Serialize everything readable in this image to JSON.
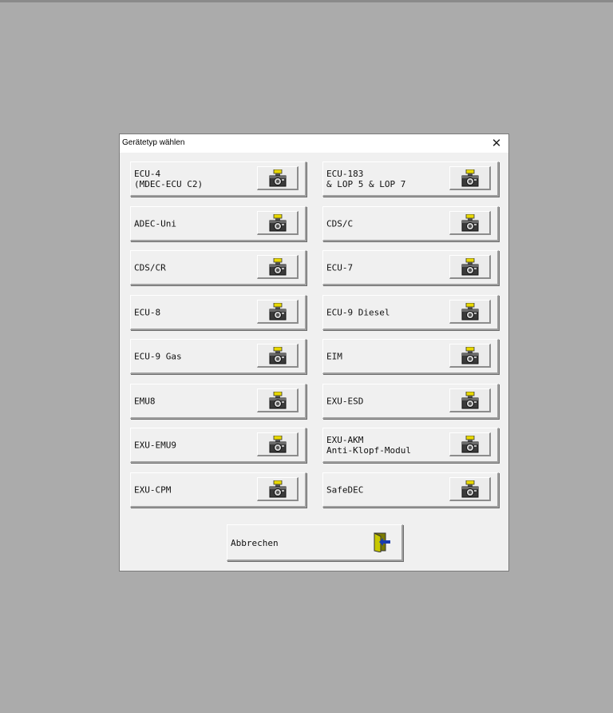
{
  "dialog": {
    "title": "Gerätetyp wählen",
    "close_symbol": "✕"
  },
  "devices": [
    {
      "line1": "ECU-4",
      "line2": "(MDEC-ECU C2)",
      "icon": "camera-icon"
    },
    {
      "line1": "ECU-183",
      "line2": "& LOP 5 & LOP 7",
      "icon": "camera-icon"
    },
    {
      "line1": "ADEC-Uni",
      "line2": "",
      "icon": "camera-icon"
    },
    {
      "line1": "CDS/C",
      "line2": "",
      "icon": "camera-icon"
    },
    {
      "line1": "CDS/CR",
      "line2": "",
      "icon": "camera-icon"
    },
    {
      "line1": "ECU-7",
      "line2": "",
      "icon": "camera-icon"
    },
    {
      "line1": "ECU-8",
      "line2": "",
      "icon": "camera-icon"
    },
    {
      "line1": "ECU-9 Diesel",
      "line2": "",
      "icon": "camera-icon"
    },
    {
      "line1": "ECU-9 Gas",
      "line2": "",
      "icon": "camera-icon"
    },
    {
      "line1": "EIM",
      "line2": "",
      "icon": "camera-icon"
    },
    {
      "line1": "EMU8",
      "line2": "",
      "icon": "camera-icon"
    },
    {
      "line1": "EXU-ESD",
      "line2": "",
      "icon": "camera-icon"
    },
    {
      "line1": "EXU-EMU9",
      "line2": "",
      "icon": "camera-icon"
    },
    {
      "line1": "EXU-AKM",
      "line2": "Anti-Klopf-Modul",
      "icon": "camera-icon"
    },
    {
      "line1": "EXU-CPM",
      "line2": "",
      "icon": "camera-icon"
    },
    {
      "line1": "SafeDEC",
      "line2": "",
      "icon": "camera-icon"
    }
  ],
  "cancel": {
    "label": "Abbrechen",
    "icon": "exit-door-icon"
  }
}
